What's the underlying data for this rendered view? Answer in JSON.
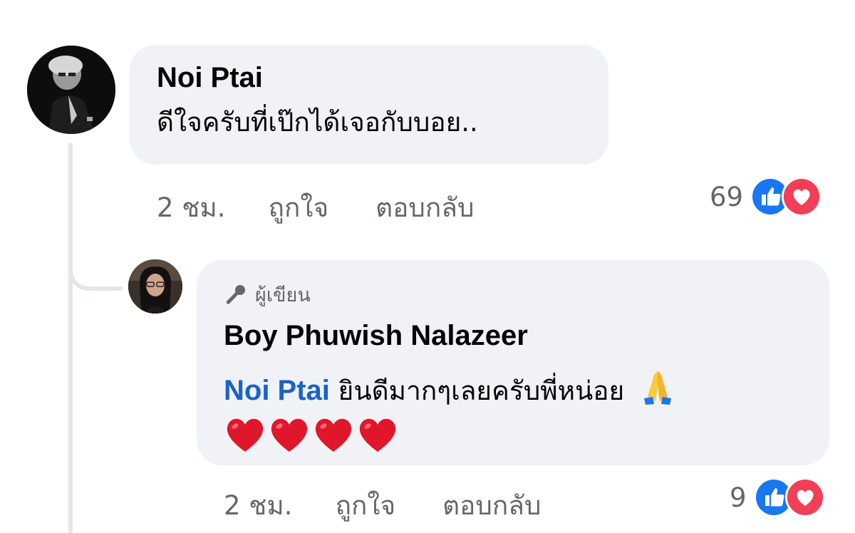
{
  "comment": {
    "author": "Noi Ptai",
    "text": "ดีใจครับที่เป๊กได้เจอกับบอย..",
    "time": "2 ชม.",
    "like_label": "ถูกใจ",
    "reply_label": "ตอบกลับ",
    "reaction_count": "69",
    "reactions": [
      "like-icon",
      "love-icon"
    ]
  },
  "reply": {
    "badge_label": "ผู้เขียน",
    "badge_icon": "microphone-icon",
    "author": "Boy Phuwish Nalazeer",
    "mention": "Noi Ptai",
    "text": "ยินดีมากๆเลยครับพี่หน่อย",
    "emoji_inline": "folded-hands-icon",
    "emoji_line": [
      "heart-icon",
      "heart-icon",
      "heart-icon",
      "heart-icon"
    ],
    "time": "2 ชม.",
    "like_label": "ถูกใจ",
    "reply_label": "ตอบกลับ",
    "reaction_count": "9",
    "reactions": [
      "like-icon",
      "love-icon"
    ]
  },
  "colors": {
    "bubble_bg": "#f0f2f5",
    "mention": "#1b62c9",
    "secondary_text": "#65676b",
    "like_blue": "#1877f2",
    "love_red": "#f33e58"
  }
}
